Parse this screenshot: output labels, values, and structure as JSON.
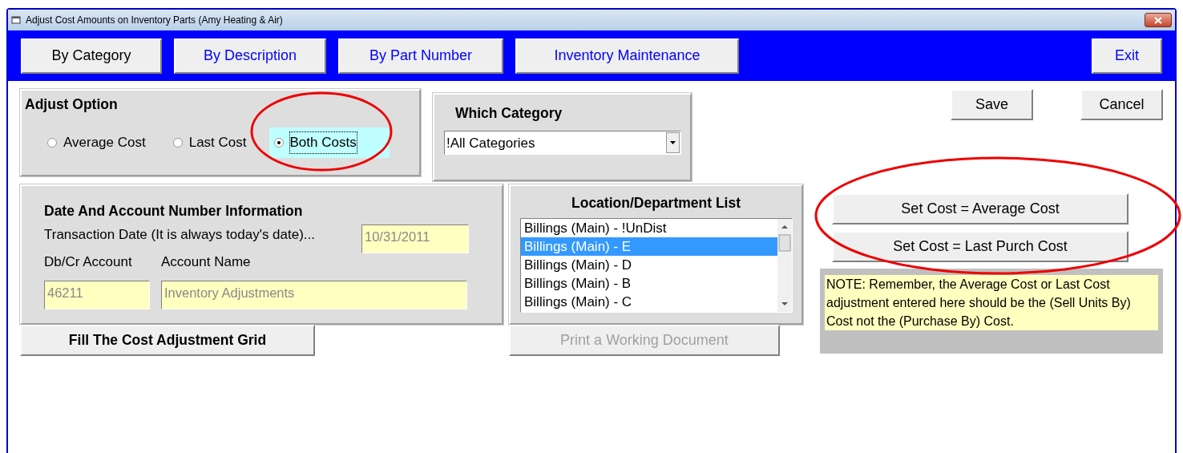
{
  "window": {
    "title": "Adjust Cost Amounts on Inventory Parts  (Amy Heating & Air)"
  },
  "toolbar": {
    "tabs": [
      {
        "label": "By Category",
        "selected": true
      },
      {
        "label": "By Description",
        "selected": false
      },
      {
        "label": "By Part Number",
        "selected": false
      },
      {
        "label": "Inventory Maintenance",
        "selected": false
      }
    ],
    "exit": "Exit"
  },
  "adjust_option": {
    "title": "Adjust Option",
    "options": [
      {
        "label": "Average Cost",
        "selected": false,
        "focused": false,
        "circled": false
      },
      {
        "label": "Last Cost",
        "selected": false,
        "focused": false,
        "circled": false
      },
      {
        "label": "Both Costs",
        "selected": true,
        "focused": true,
        "circled": true
      }
    ]
  },
  "which_category": {
    "title": "Which Category",
    "value": "!All Categories"
  },
  "actions": {
    "save": "Save",
    "cancel": "Cancel"
  },
  "date_account": {
    "title": "Date And Account Number Information",
    "date_label": "Transaction Date (It is always today's date)...",
    "date_value": "10/31/2011",
    "account_label": "Db/Cr Account",
    "account_name_label": "Account Name",
    "account_value": "46211",
    "account_name_value": "Inventory Adjustments"
  },
  "location_list": {
    "title": "Location/Department List",
    "items": [
      {
        "label": "Billings (Main) - !UnDist",
        "selected": false
      },
      {
        "label": "Billings (Main) - E",
        "selected": true
      },
      {
        "label": "Billings (Main) - D",
        "selected": false
      },
      {
        "label": "Billings (Main) - B",
        "selected": false
      },
      {
        "label": "Billings (Main) - C",
        "selected": false
      }
    ]
  },
  "fill_button": {
    "label": "Fill The Cost Adjustment  Grid",
    "disabled": false
  },
  "print_button": {
    "label": "Print a Working Document",
    "disabled": true
  },
  "set_cost": {
    "circled": true,
    "buttons": [
      "Set Cost = Average Cost",
      "Set Cost = Last Purch Cost"
    ]
  },
  "note": "NOTE: Remember, the Average Cost or Last Cost adjustment entered here should be the (Sell Units By) Cost not the (Purchase By) Cost."
}
